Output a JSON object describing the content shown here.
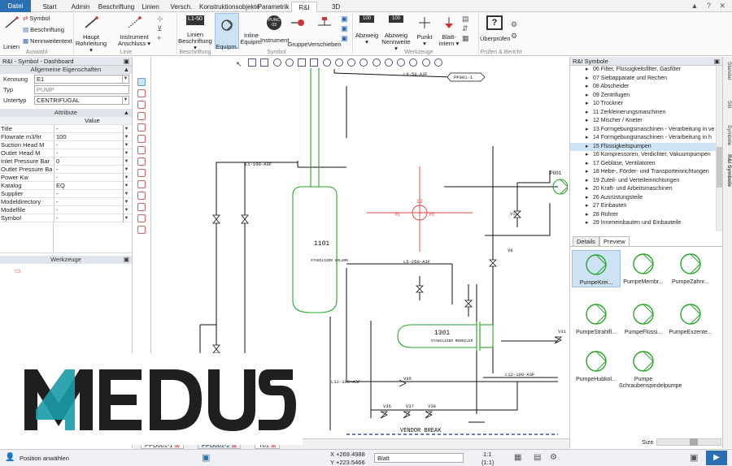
{
  "tabs": [
    "Datei",
    "Start",
    "Admin",
    "Beschriftung",
    "Linien",
    "Versch.",
    "Konstruktionsobjekte",
    "Parametrik",
    "R&I",
    "3D"
  ],
  "ribbon": {
    "small_items": [
      "Symbol",
      "Beschriftung",
      "Nennweitentext"
    ],
    "buttons": [
      {
        "label": "Linien"
      },
      {
        "label": "Haupt\nRohrleitung ▾"
      },
      {
        "label": "Instrument\nAnschluss ▾"
      },
      {
        "label": "Linien\nBeschriftung ▾"
      },
      {
        "label": "Equipm."
      },
      {
        "label": "Inline\nEquipm."
      },
      {
        "label": "Instrument"
      },
      {
        "label": "Gruppe"
      },
      {
        "label": "Verschieben"
      },
      {
        "label": "Abzweig\n▾"
      },
      {
        "label": "Abzweig\nNennweite ▾"
      },
      {
        "label": "Punkt\n▾"
      },
      {
        "label": "Blatt-\nintern ▾"
      },
      {
        "label": "Überprüfen"
      }
    ],
    "groups": [
      "Auswahl",
      "Linie",
      "Beschriftung",
      "Symbol",
      "Werkzeuge",
      "Prüfen & Bericht"
    ],
    "icon_texts": {
      "linie_badge": "L1-50",
      "punc_badge": "PUNC\n03",
      "num_badge": "100"
    }
  },
  "left_panel": {
    "title": "R&I - Symbol - Dashboard",
    "general_header": "Allgemeine Eigenschaften",
    "fields": [
      {
        "label": "Kennung",
        "value": "E1"
      },
      {
        "label": "Typ",
        "value": "PUMP"
      },
      {
        "label": "Untertyp",
        "value": "CENTRIFUGAL"
      }
    ],
    "attr_header": "Attribute",
    "value_header": "Value",
    "attributes": [
      {
        "key": "Title",
        "value": "-"
      },
      {
        "key": "Flowrate m3/hr",
        "value": "100"
      },
      {
        "key": "Suction Head M",
        "value": "-"
      },
      {
        "key": "Outlet Head M",
        "value": "-"
      },
      {
        "key": "Inlet Pressure Bar",
        "value": "0"
      },
      {
        "key": "Outlet Pressure Bar",
        "value": "-"
      },
      {
        "key": "Power Kw",
        "value": "-"
      },
      {
        "key": "Katalog",
        "value": "EQ"
      },
      {
        "key": "Supplier",
        "value": "-"
      },
      {
        "key": "Modeldirectory",
        "value": "-"
      },
      {
        "key": "Modelfile",
        "value": "-"
      },
      {
        "key": "Symbol",
        "value": "-"
      }
    ],
    "tools_header": "Werkzeuge"
  },
  "drawing": {
    "labels": [
      "L9-50-A3F",
      "PP001-1",
      "L1-100-A3F",
      "1101",
      "STABILIZER\nCOLUMN",
      "P1",
      "P2",
      "12",
      "PU01",
      "L5-250-A3F",
      "1301",
      "STABILIZER\nREBOILER",
      "L12-100-A3F",
      "L12-100-A3F",
      "VENDOR BREAK",
      "V35",
      "V36",
      "V37",
      "V38",
      "V31",
      "V15",
      "V8"
    ]
  },
  "doc_tabs": [
    "PPD001-1",
    "PPD001-2",
    "T01"
  ],
  "right_panel": {
    "title": "R&I Symbole",
    "tree": [
      "06 Filter, Flüssigkeitsfilter, Gasfilter",
      "07 Siebapparate und Rechen",
      "08 Abscheider",
      "09 Zentrifugen",
      "10 Trockner",
      "11 Zerkleinerungsmaschinen",
      "12 Mischer / Kneter",
      "13 Formgebungsmaschinen - Verarbeitung in ve",
      "14 Formgebungsmaschinen - Verarbeitung in h",
      "15 Flüssigkeitspumpen",
      "16 Kompressoren, Verdichter, Vakuumpumpen",
      "17 Gebläse, Ventilatoren",
      "18 Hebe-, Förder- und Transporteinrichtungen",
      "19 Zuteil- und Verteileinrichtungen",
      "20 Kraft- und Arbeitsmaschinen",
      "26 Ausrüstungsteile",
      "27 Einbauten",
      "28 Rührer",
      "29 Inneneinbauten und Einbauteile"
    ],
    "selected_index": 9,
    "preview_tabs": [
      "Details",
      "Preview"
    ],
    "preview": [
      "PumpeKrei...",
      "PumpeMembr...",
      "PumpeZahnr...",
      "PumpeStrahlfl...",
      "PumpeFlüssi...",
      "PumpeExzente...",
      "PumpeHubkol...",
      "Pumpe\nSchraubenspindelpumpe"
    ],
    "size_label": "Size"
  },
  "side_tabs": [
    "Standar",
    "Stil",
    "Symbole",
    "R&I Symbole"
  ],
  "status": {
    "message": "Position anwählen",
    "x": "X +269.4988",
    "y": "Y +223.5466",
    "sheet": "Blatt",
    "scale": "1:1",
    "scale2": "(1:1)"
  },
  "logo": "M4EDUSA",
  "colors": {
    "accent": "#2b6fb3",
    "equipment": "#2aa52a",
    "selection": "#e0413c",
    "pipe": "#111111"
  }
}
